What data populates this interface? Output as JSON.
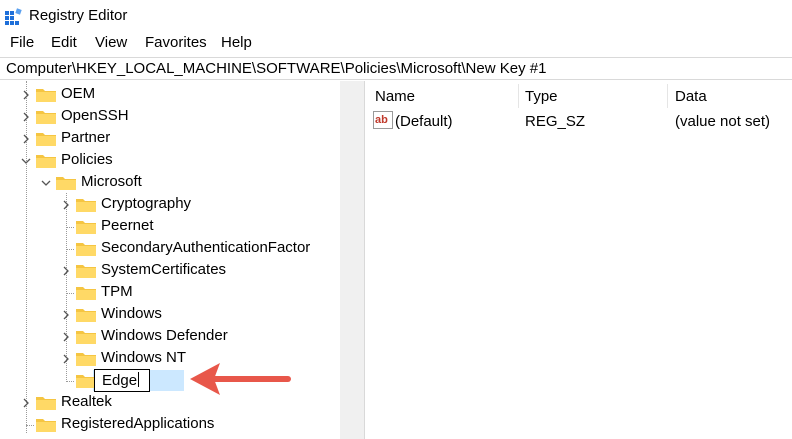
{
  "window": {
    "title": "Registry Editor"
  },
  "menu": [
    "File",
    "Edit",
    "View",
    "Favorites",
    "Help"
  ],
  "address": {
    "path": "Computer\\HKEY_LOCAL_MACHINE\\SOFTWARE\\Policies\\Microsoft\\New Key #1"
  },
  "tree": {
    "items": [
      {
        "label": "OEM"
      },
      {
        "label": "OpenSSH"
      },
      {
        "label": "Partner"
      },
      {
        "label": "Policies"
      },
      {
        "label": "Microsoft"
      },
      {
        "label": "Cryptography"
      },
      {
        "label": "Peernet"
      },
      {
        "label": "SecondaryAuthenticationFactor"
      },
      {
        "label": "SystemCertificates"
      },
      {
        "label": "TPM"
      },
      {
        "label": "Windows"
      },
      {
        "label": "Windows Defender"
      },
      {
        "label": "Windows NT"
      },
      {
        "label": "Realtek"
      },
      {
        "label": "RegisteredApplications"
      }
    ],
    "rename_value": "Edge"
  },
  "values": {
    "columns": [
      "Name",
      "Type",
      "Data"
    ],
    "rows": [
      {
        "name": "(Default)",
        "type": "REG_SZ",
        "data": "(value not set)"
      }
    ]
  },
  "colors": {
    "folder": "#f5c542",
    "selection": "#cce8ff",
    "arrow": "#e8574a",
    "icon_blue": "#1e6fd9"
  },
  "icons": {
    "app": "registry-editor-icon",
    "string_value": "string-value-icon",
    "folder": "folder-icon"
  }
}
